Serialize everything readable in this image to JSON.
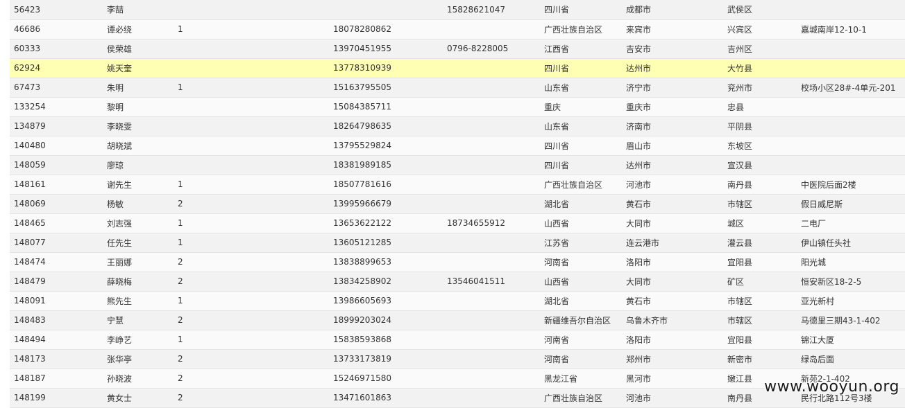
{
  "table": {
    "rows": [
      [
        "56423",
        "李喆",
        "",
        "",
        "15828621047",
        "四川省",
        "成都市",
        "武侯区",
        ""
      ],
      [
        "46686",
        "谭必绕",
        "1",
        "18078280862",
        "",
        "广西壮族自治区",
        "来宾市",
        "兴宾区",
        "嘉城南岸12-10-1"
      ],
      [
        "60333",
        "侯荣雄",
        "",
        "13970451955",
        "0796-8228005",
        "江西省",
        "吉安市",
        "吉州区",
        ""
      ],
      [
        "62924",
        "姚天奎",
        "",
        "13778310939",
        "",
        "四川省",
        "达州市",
        "大竹县",
        ""
      ],
      [
        "67473",
        "朱明",
        "1",
        "15163795505",
        "",
        "山东省",
        "济宁市",
        "兖州市",
        "校场小区28#-4单元-201"
      ],
      [
        "133254",
        "黎明",
        "",
        "15084385711",
        "",
        "重庆",
        "重庆市",
        "忠县",
        ""
      ],
      [
        "134879",
        "李晓雯",
        "",
        "18264798635",
        "",
        "山东省",
        "济南市",
        "平阴县",
        ""
      ],
      [
        "140480",
        "胡晓斌",
        "",
        "13795529824",
        "",
        "四川省",
        "眉山市",
        "东坡区",
        ""
      ],
      [
        "148059",
        "廖琼",
        "",
        "18381989185",
        "",
        "四川省",
        "达州市",
        "宣汉县",
        ""
      ],
      [
        "148161",
        "谢先生",
        "1",
        "18507781616",
        "",
        "广西壮族自治区",
        "河池市",
        "南丹县",
        "中医院后面2楼"
      ],
      [
        "148069",
        "杨敏",
        "2",
        "13995966679",
        "",
        "湖北省",
        "黄石市",
        "市辖区",
        "假日威尼斯"
      ],
      [
        "148465",
        "刘志强",
        "1",
        "13653622122",
        "18734655912",
        "山西省",
        "大同市",
        "城区",
        "二电厂"
      ],
      [
        "148077",
        "任先生",
        "1",
        "13605121285",
        "",
        "江苏省",
        "连云港市",
        "灌云县",
        "伊山镇任头社"
      ],
      [
        "148474",
        "王丽娜",
        "2",
        "13838899653",
        "",
        "河南省",
        "洛阳市",
        "宜阳县",
        "阳光城"
      ],
      [
        "148479",
        "薛晓梅",
        "2",
        "13834258902",
        "13546041511",
        "山西省",
        "大同市",
        "矿区",
        "恒安新区18-2-5"
      ],
      [
        "148091",
        "熊先生",
        "1",
        "13986605693",
        "",
        "湖北省",
        "黄石市",
        "市辖区",
        "亚光新村"
      ],
      [
        "148483",
        "宁慧",
        "2",
        "18999203024",
        "",
        "新疆维吾尔自治区",
        "乌鲁木齐市",
        "市辖区",
        "马德里三期43-1-402"
      ],
      [
        "148494",
        "李峥艺",
        "1",
        "15838593868",
        "",
        "河南省",
        "洛阳市",
        "宜阳县",
        "锦江大厦"
      ],
      [
        "148173",
        "张华亭",
        "2",
        "13733173819",
        "",
        "河南省",
        "郑州市",
        "新密市",
        "绿岛后面"
      ],
      [
        "148187",
        "孙晓波",
        "2",
        "15246971580",
        "",
        "黑龙江省",
        "黑河市",
        "嫩江县",
        "新苑2-1-402"
      ],
      [
        "148199",
        "黄女士",
        "2",
        "13471601863",
        "",
        "广西壮族自治区",
        "河池市",
        "南丹县",
        "民行北路112号3楼"
      ]
    ],
    "highlight_row": 3,
    "highlight_color": "#ffffb3"
  },
  "watermark": {
    "text": "www.wooyun.org"
  }
}
